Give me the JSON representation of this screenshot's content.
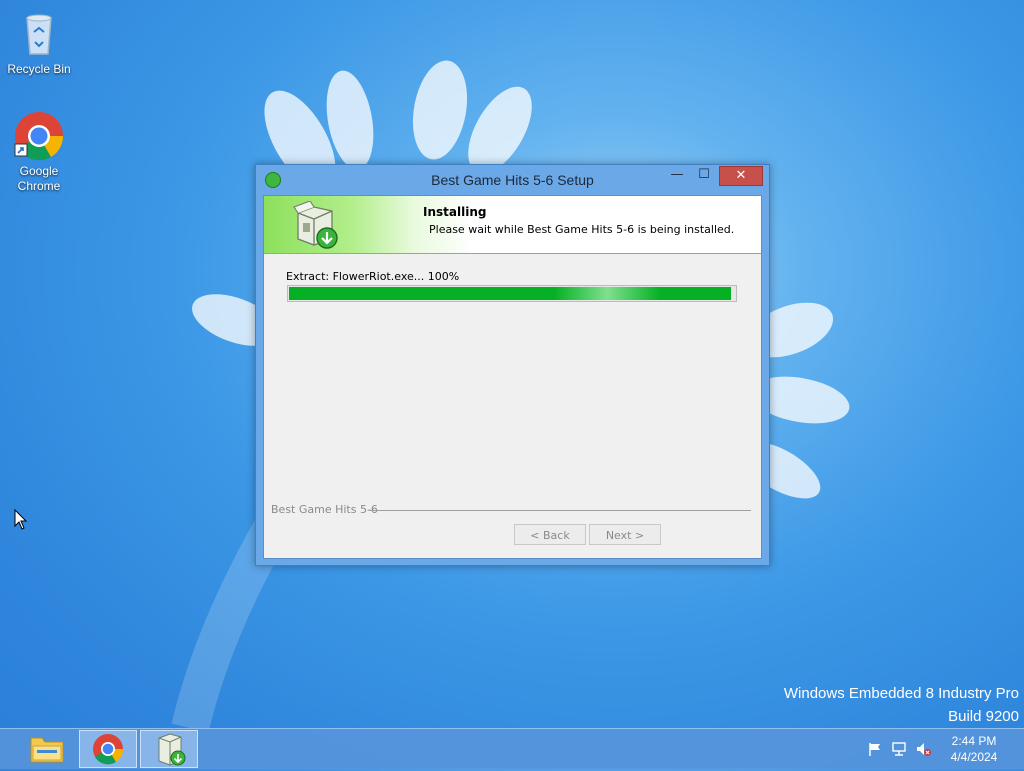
{
  "desktop": {
    "icons": [
      {
        "label": "Recycle Bin"
      },
      {
        "label": "Google Chrome"
      }
    ],
    "watermark": {
      "line1": "Windows Embedded 8 Industry Pro",
      "line2": "Build 9200"
    }
  },
  "window": {
    "title": "Best Game Hits 5-6 Setup",
    "buttons": {
      "minimize": "—",
      "maximize": "☐",
      "close": "✕"
    },
    "header": {
      "heading": "Installing",
      "subtext": "Please wait while Best Game Hits 5-6 is being installed."
    },
    "status_text": "Extract: FlowerRiot.exe... 100%",
    "progress_percent": 99,
    "footer_label": "Best Game Hits 5-6",
    "back_label": "< Back",
    "next_label": "Next >"
  },
  "taskbar": {
    "items": [
      {
        "name": "file-explorer"
      },
      {
        "name": "google-chrome"
      },
      {
        "name": "setup-installer"
      }
    ],
    "time": "2:44 PM",
    "date": "4/4/2024"
  },
  "colors": {
    "progress_fill": "#06b025",
    "close_button": "#c7504b",
    "desktop_blue": "#2f86dc"
  }
}
